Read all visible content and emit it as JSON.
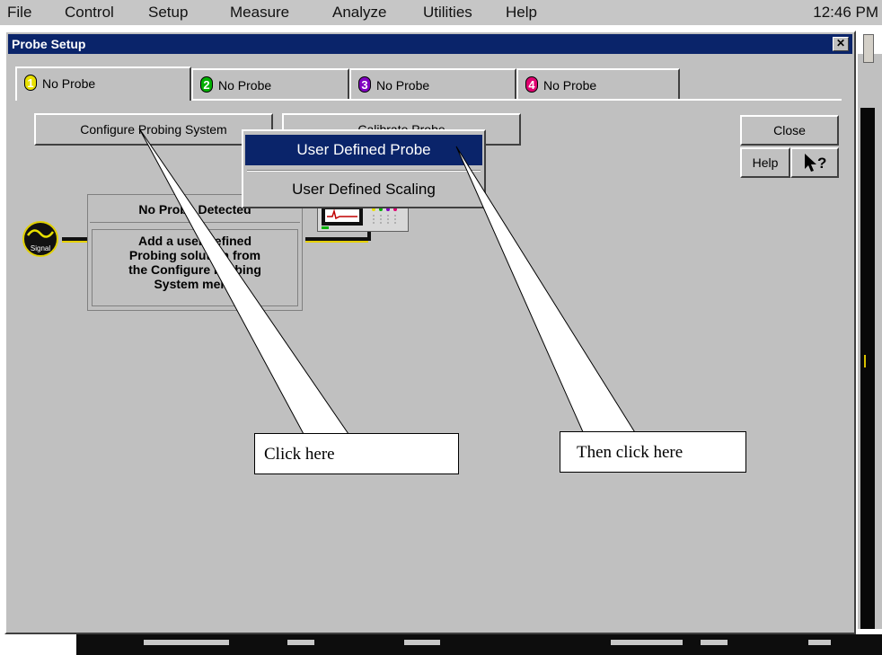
{
  "menubar": {
    "items": [
      "File",
      "Control",
      "Setup",
      "Measure",
      "Analyze",
      "Utilities",
      "Help"
    ],
    "clock": "12:46 PM"
  },
  "dialog": {
    "title": "Probe Setup",
    "close_glyph": "✕",
    "tabs": [
      {
        "number": "1",
        "label": "No Probe",
        "color": "#e8e000"
      },
      {
        "number": "2",
        "label": "No Probe",
        "color": "#00b000"
      },
      {
        "number": "3",
        "label": "No Probe",
        "color": "#8000c0"
      },
      {
        "number": "4",
        "label": "No Probe",
        "color": "#e00070"
      }
    ],
    "buttons": {
      "configure": "Configure Probing System",
      "calibrate": "Calibrate Probe",
      "close": "Close",
      "help": "Help",
      "whats_this": "?"
    },
    "dropdown": {
      "items": [
        "User Defined Probe",
        "User Defined Scaling"
      ]
    },
    "probe_status": {
      "header": "No Probe Detected",
      "message_lines": [
        "Add a user defined",
        "Probing solution from",
        "the Configure Probing",
        "System menu"
      ]
    },
    "signal_label": "Signal"
  },
  "callouts": {
    "first": "Click here",
    "second": "Then click here"
  }
}
